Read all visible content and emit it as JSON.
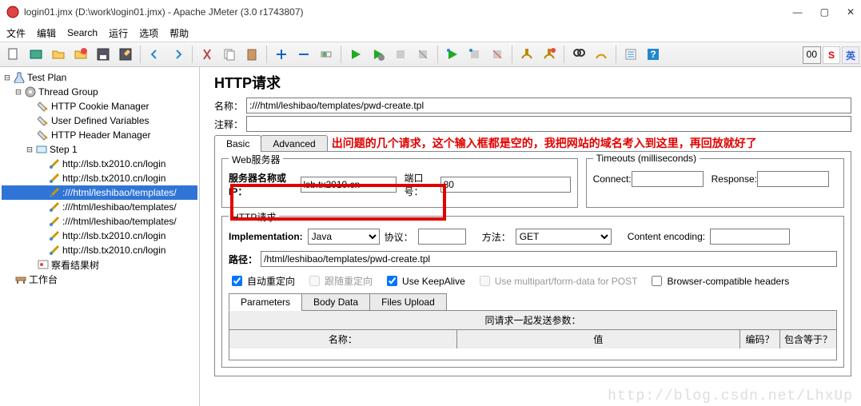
{
  "window": {
    "title": "login01.jmx (D:\\work\\login01.jmx) - Apache JMeter (3.0 r1743807)"
  },
  "menu": {
    "file": "文件",
    "edit": "编辑",
    "search": "Search",
    "run": "运行",
    "options": "选项",
    "help": "帮助"
  },
  "tree": {
    "root": "Test Plan",
    "group": "Thread Group",
    "cookie": "HTTP Cookie Manager",
    "vars": "User Defined Variables",
    "header": "HTTP Header Manager",
    "step": "Step 1",
    "req1": "http://lsb.tx2010.cn/login",
    "req2": "http://lsb.tx2010.cn/login",
    "req3": ":///html/leshibao/templates/",
    "req4": ":///html/leshibao/templates/",
    "req5": ":///html/leshibao/templates/",
    "req6": "http://lsb.tx2010.cn/login",
    "req7": "http://lsb.tx2010.cn/login",
    "results": "察看结果树",
    "workbench": "工作台"
  },
  "form": {
    "title": "HTTP请求",
    "name_lbl": "名称：",
    "name_val": ":///html/leshibao/templates/pwd-create.tpl",
    "comment_lbl": "注释：",
    "basic": "Basic",
    "advanced": "Advanced",
    "annotation": "出问题的几个请求，这个输入框都是空的，我把网站的域名考入到这里，再回放就好了",
    "webserver": "Web服务器",
    "server_lbl": "服务器名称或IP：",
    "server_val": "lsb.tx2010.cn",
    "port_lbl": "端口号：",
    "port_val": "80",
    "timeouts": "Timeouts (milliseconds)",
    "connect": "Connect:",
    "response": "Response:",
    "httpreq": "HTTP请求",
    "impl": "Implementation:",
    "impl_val": "Java",
    "protocol": "协议：",
    "method": "方法：",
    "method_val": "GET",
    "encoding": "Content encoding:",
    "path_lbl": "路径：",
    "path_val": "/html/leshibao/templates/pwd-create.tpl",
    "auto_redirect": "自动重定向",
    "follow_redirect": "跟随重定向",
    "keepalive": "Use KeepAlive",
    "multipart": "Use multipart/form-data for POST",
    "browser_compat": "Browser-compatible headers",
    "params": "Parameters",
    "bodydata": "Body Data",
    "files": "Files Upload",
    "grid_title": "同请求一起发送参数：",
    "col_name": "名称：",
    "col_value": "值",
    "col_encode": "编码？",
    "col_include": "包含等于？"
  },
  "watermark": "http://blog.csdn.net/LhxUp",
  "ime": {
    "s": "S",
    "cn": "英"
  },
  "toolbar_counter": "00"
}
